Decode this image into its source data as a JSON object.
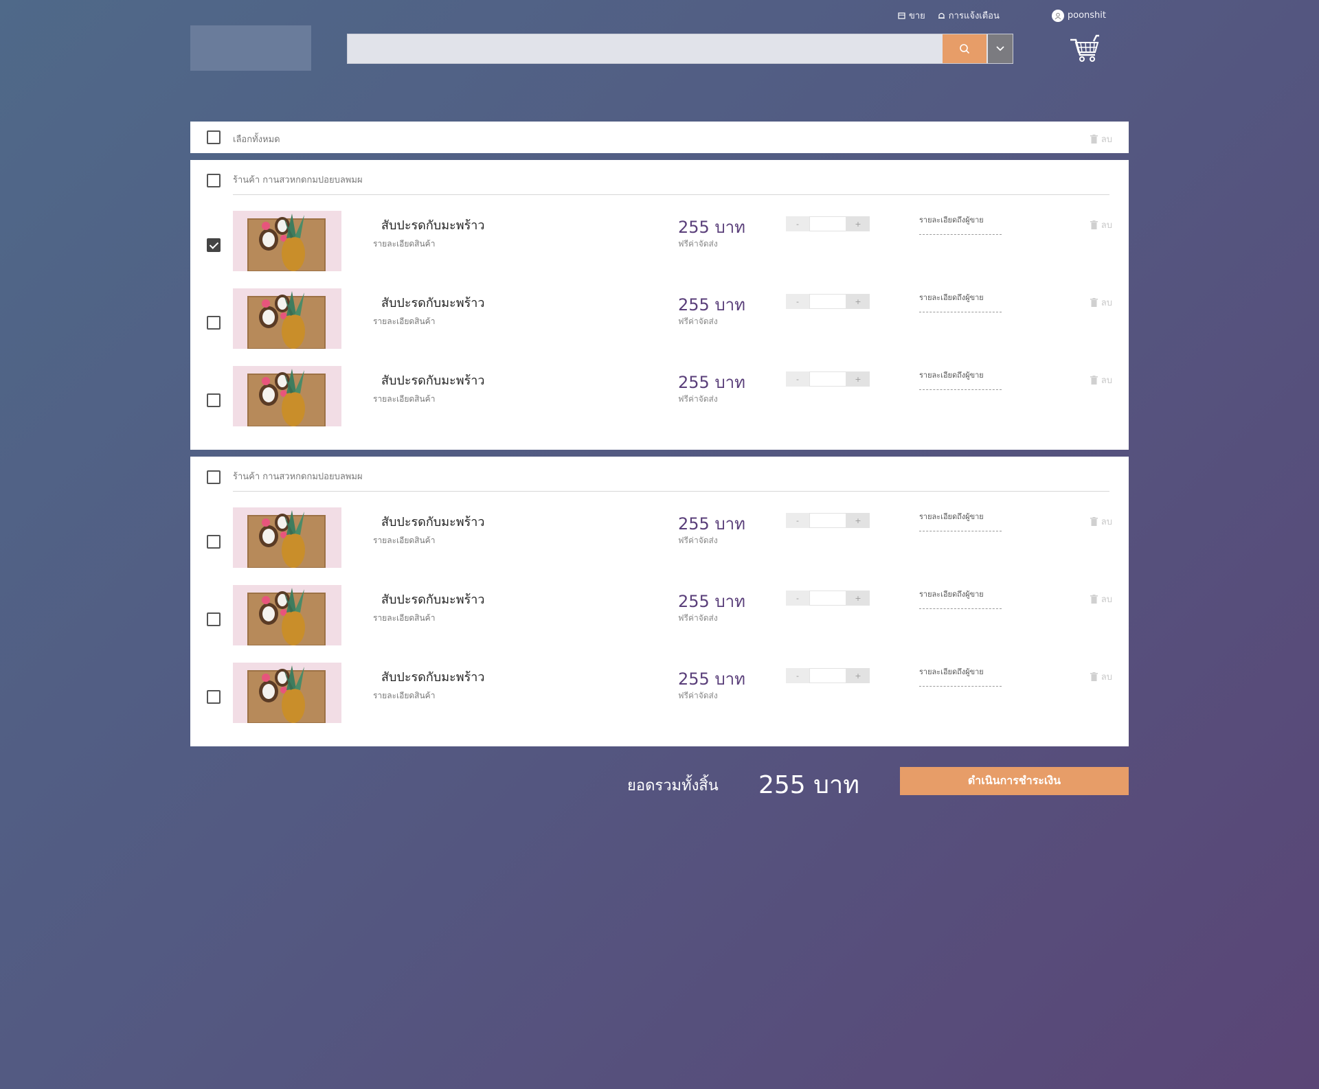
{
  "topnav": {
    "sell_label": "ขาย",
    "sell_icon": "store-icon",
    "notify_label": "การแจ้งเตือน",
    "notify_icon": "bell-icon",
    "username": "poonshit",
    "user_icon": "user-icon"
  },
  "search": {
    "placeholder": "",
    "button_icon": "search-icon",
    "dropdown_icon": "chevron-down-icon"
  },
  "cart_icon": "cart-icon",
  "select_all": {
    "label": "เลือกทั้งหมด",
    "checked": false,
    "delete_label": "ลบ"
  },
  "shops": [
    {
      "name": "ร้านค้า กานสวหกดกมปอยบลพมผ",
      "checked": false,
      "items": [
        {
          "name": "สับปะรดกับมะพร้าว",
          "desc": "รายละเอียดสินค้า",
          "price": "255 บาท",
          "shipping": "ฟรีค่าจัดส่ง",
          "qty": "",
          "note_label": "รายละเอียดถึงผู้ขาย",
          "delete_label": "ลบ",
          "checked": true
        },
        {
          "name": "สับปะรดกับมะพร้าว",
          "desc": "รายละเอียดสินค้า",
          "price": "255 บาท",
          "shipping": "ฟรีค่าจัดส่ง",
          "qty": "",
          "note_label": "รายละเอียดถึงผู้ขาย",
          "delete_label": "ลบ",
          "checked": false
        },
        {
          "name": "สับปะรดกับมะพร้าว",
          "desc": "รายละเอียดสินค้า",
          "price": "255 บาท",
          "shipping": "ฟรีค่าจัดส่ง",
          "qty": "",
          "note_label": "รายละเอียดถึงผู้ขาย",
          "delete_label": "ลบ",
          "checked": false
        }
      ]
    },
    {
      "name": "ร้านค้า กานสวหกดกมปอยบลพมผ",
      "checked": false,
      "items": [
        {
          "name": "สับปะรดกับมะพร้าว",
          "desc": "รายละเอียดสินค้า",
          "price": "255 บาท",
          "shipping": "ฟรีค่าจัดส่ง",
          "qty": "",
          "note_label": "รายละเอียดถึงผู้ขาย",
          "delete_label": "ลบ",
          "checked": false
        },
        {
          "name": "สับปะรดกับมะพร้าว",
          "desc": "รายละเอียดสินค้า",
          "price": "255 บาท",
          "shipping": "ฟรีค่าจัดส่ง",
          "qty": "",
          "note_label": "รายละเอียดถึงผู้ขาย",
          "delete_label": "ลบ",
          "checked": false
        },
        {
          "name": "สับปะรดกับมะพร้าว",
          "desc": "รายละเอียดสินค้า",
          "price": "255 บาท",
          "shipping": "ฟรีค่าจัดส่ง",
          "qty": "",
          "note_label": "รายละเอียดถึงผู้ขาย",
          "delete_label": "ลบ",
          "checked": false
        }
      ]
    }
  ],
  "qty_controls": {
    "minus": "-",
    "plus": "+"
  },
  "summary": {
    "total_label": "ยอดรวมทั้งสิ้น",
    "total_value": "255 บาท",
    "checkout_label": "ดำเนินการชำระเงิน"
  },
  "colors": {
    "accent": "#e79d68",
    "price": "#5a3f7a"
  }
}
